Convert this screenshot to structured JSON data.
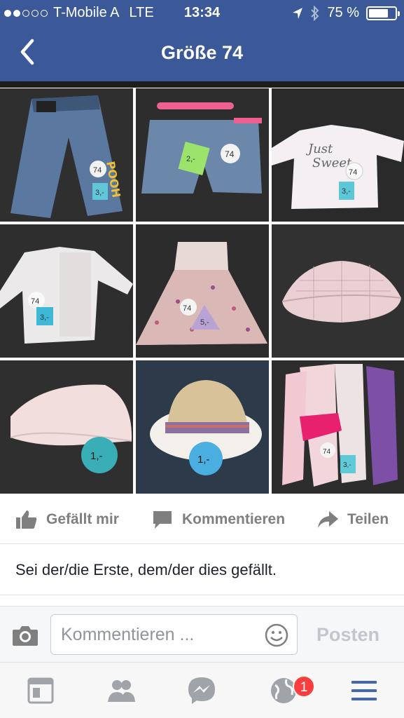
{
  "status_bar": {
    "carrier": "T-Mobile A",
    "network": "LTE",
    "time": "13:34",
    "battery_percent": "75 %",
    "battery_level": 0.75,
    "signal_bars_filled": 2,
    "signal_bars_total": 5
  },
  "nav": {
    "title": "Größe 74",
    "back_icon": "chevron-left-icon"
  },
  "photos": [
    {
      "label": "jeans-pooh",
      "tags": [
        "74",
        "3,-"
      ]
    },
    {
      "label": "denim-shorts",
      "tags": [
        "74",
        "2,-"
      ]
    },
    {
      "label": "just-sweet-longsleeve",
      "tags": [
        "Just",
        "Sweet",
        "74",
        "3,-"
      ]
    },
    {
      "label": "cardigan",
      "tags": [
        "74",
        "3,-"
      ]
    },
    {
      "label": "floral-dress",
      "tags": [
        "74",
        "5,-"
      ]
    },
    {
      "label": "sun-hat-plaid",
      "tags": []
    },
    {
      "label": "cap-white",
      "tags": [
        "1,-"
      ]
    },
    {
      "label": "straw-hat",
      "tags": [
        "1,-"
      ]
    },
    {
      "label": "socks-tights",
      "tags": [
        "74",
        "3,-"
      ]
    }
  ],
  "actions": {
    "like": "Gefällt mir",
    "comment": "Kommentieren",
    "share": "Teilen"
  },
  "likes_text": "Sei der/die Erste, dem/der dies gefällt.",
  "composer": {
    "placeholder": "Kommentieren ...",
    "post_label": "Posten"
  },
  "tabbar": {
    "items": [
      "news-feed-icon",
      "friends-icon",
      "messenger-icon",
      "notifications-globe-icon",
      "menu-icon"
    ],
    "notification_count": "1"
  },
  "colors": {
    "brand": "#3b5998",
    "badge": "#fa3e3e",
    "active_tab": "#4267b2"
  }
}
